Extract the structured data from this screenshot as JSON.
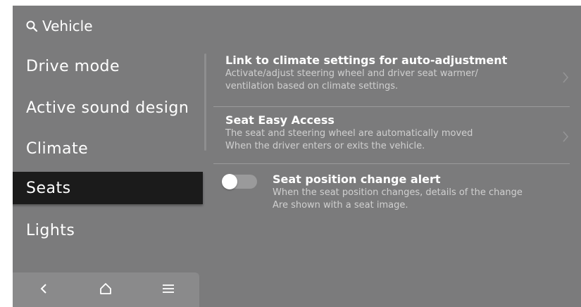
{
  "header": {
    "icon": "search-icon",
    "title": "Vehicle"
  },
  "sidebar": {
    "items": [
      {
        "label": "Drive mode"
      },
      {
        "label": "Active sound design"
      },
      {
        "label": "Climate"
      },
      {
        "label": "Seats",
        "selected": true
      },
      {
        "label": "Lights"
      }
    ]
  },
  "bottom_nav": {
    "buttons": [
      {
        "icon": "back-icon"
      },
      {
        "icon": "home-icon"
      },
      {
        "icon": "menu-icon"
      }
    ]
  },
  "settings": [
    {
      "title": "Link to climate settings for auto-adjustment",
      "desc_line1": "Activate/adjust steering wheel and driver seat warmer/",
      "desc_line2": "ventilation based on climate settings.",
      "control": "chevron-right-icon"
    },
    {
      "title": "Seat Easy Access",
      "desc_line1": "The seat and steering wheel are automatically moved",
      "desc_line2": "When the driver enters or exits the vehicle.",
      "control": "chevron-right-icon"
    },
    {
      "title": "Seat position change alert",
      "desc_line1": "When the seat position changes, details of the change",
      "desc_line2": "Are shown with a seat image.",
      "control": "toggle-switch",
      "toggle_on": false
    }
  ],
  "colors": {
    "screen_bg": "#7b7b7c",
    "selected_bg": "#1b1b1b",
    "nav_bg": "#8a8a8b",
    "text": "#ffffff",
    "desc_text": "#d0d0d0"
  }
}
